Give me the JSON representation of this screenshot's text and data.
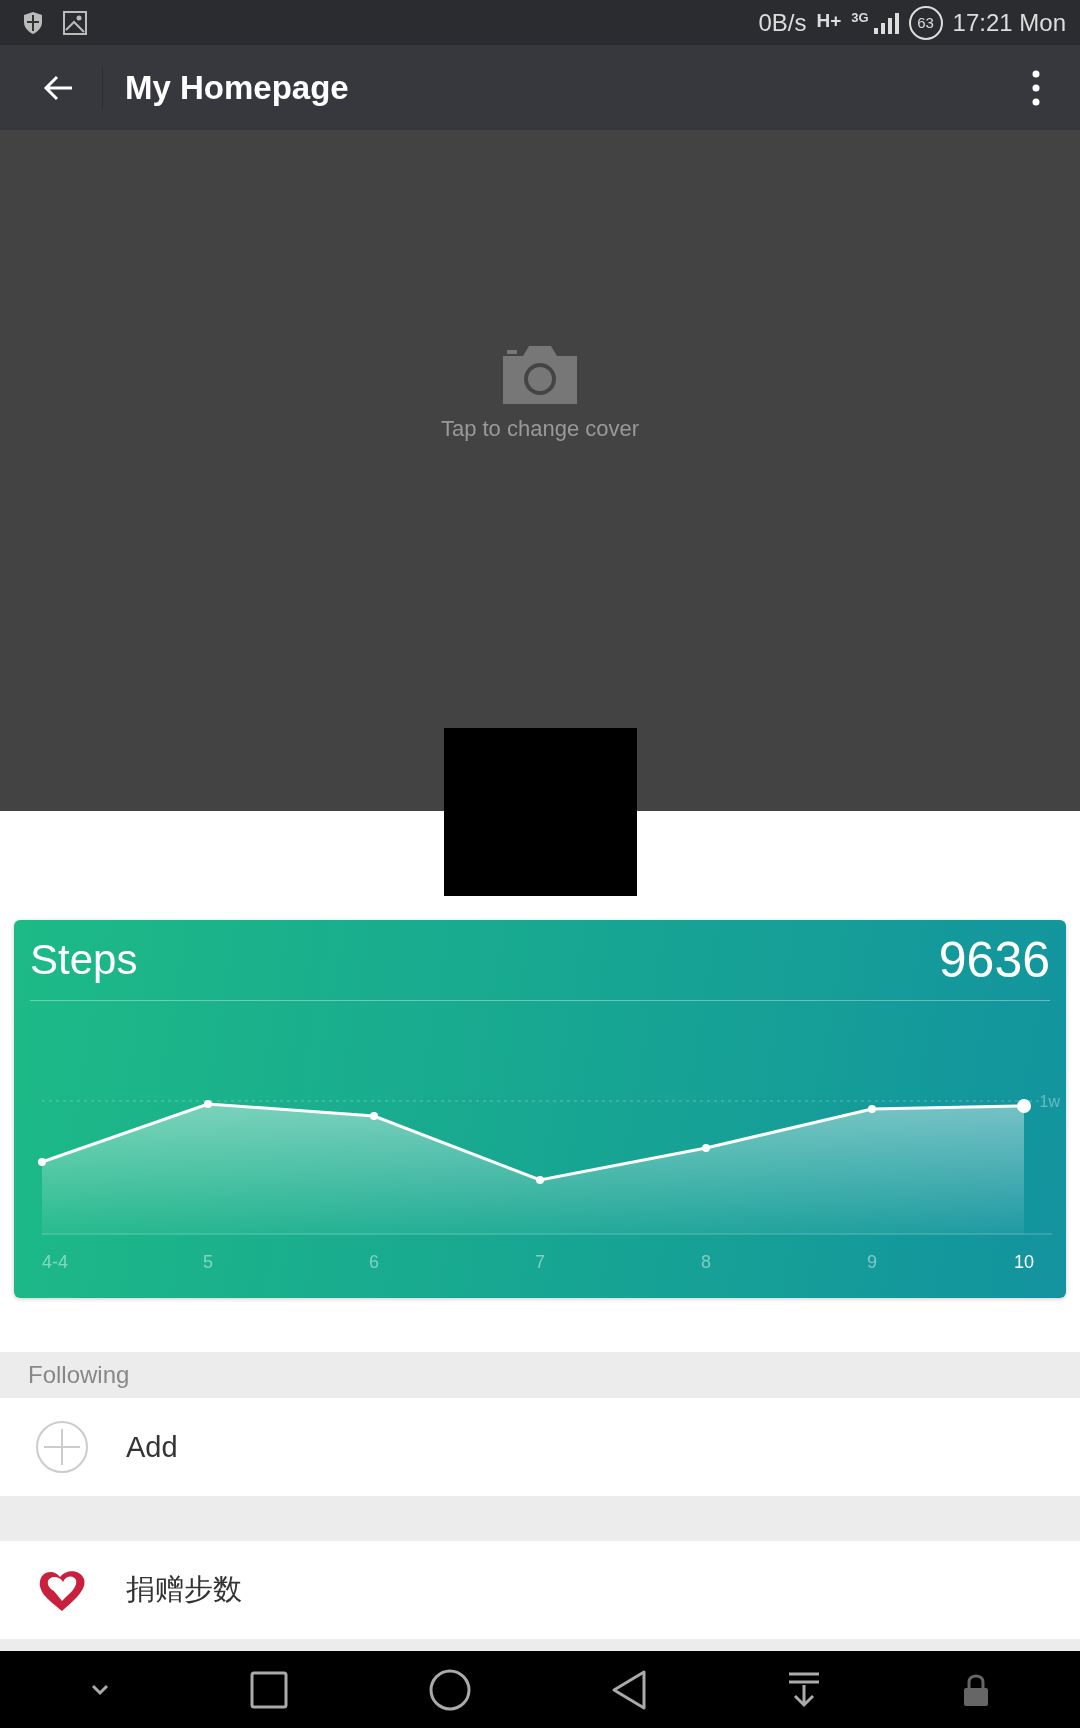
{
  "status_bar": {
    "speed": "0B/s",
    "network": "H+",
    "generation": "3G",
    "battery": "63",
    "time": "17:21 Mon"
  },
  "app_bar": {
    "title": "My Homepage"
  },
  "cover": {
    "hint": "Tap to change cover"
  },
  "steps_card": {
    "title": "Steps",
    "count": "9636",
    "reference_label": "1w",
    "x_labels": [
      {
        "label": "4-4",
        "selected": false
      },
      {
        "label": "5",
        "selected": false
      },
      {
        "label": "6",
        "selected": false
      },
      {
        "label": "7",
        "selected": false
      },
      {
        "label": "8",
        "selected": false
      },
      {
        "label": "9",
        "selected": false
      },
      {
        "label": "10",
        "selected": true
      }
    ]
  },
  "following": {
    "header": "Following",
    "add_label": "Add"
  },
  "donate": {
    "label": "捐赠步数"
  }
}
